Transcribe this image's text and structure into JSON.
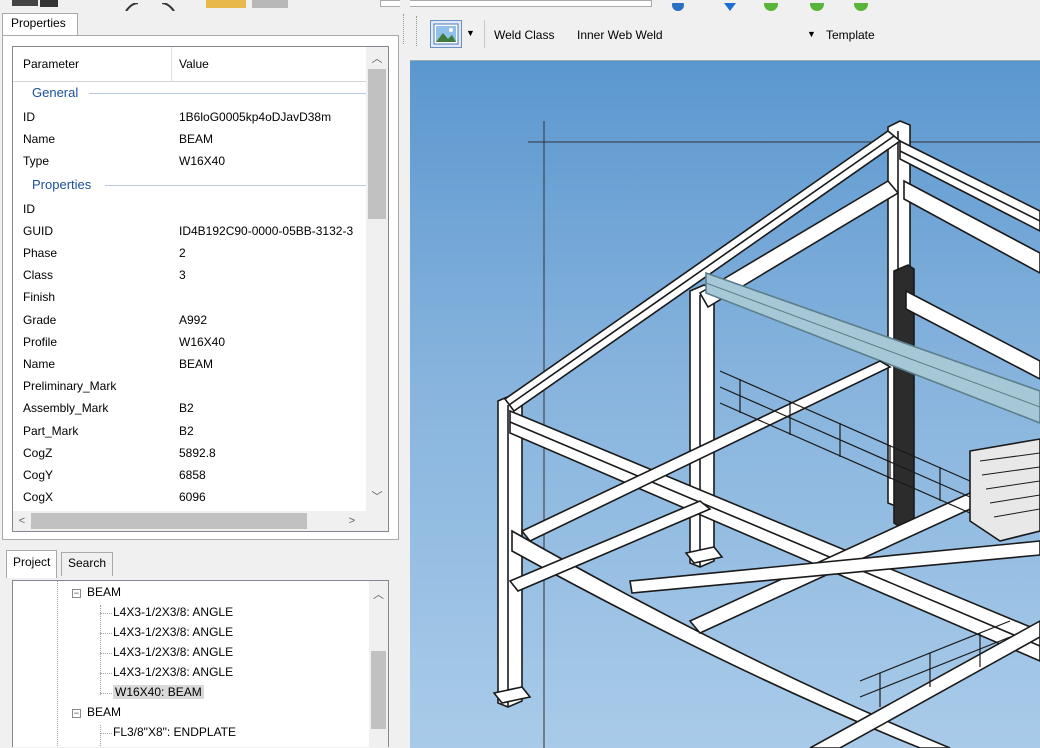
{
  "properties_panel": {
    "tab_label": "Properties",
    "columns": {
      "parameter": "Parameter",
      "value": "Value"
    },
    "categories": [
      {
        "title": "General",
        "rows": [
          {
            "k": "ID",
            "v": "1B6loG0005kp4oDJavD38m"
          },
          {
            "k": "Name",
            "v": "BEAM"
          },
          {
            "k": "Type",
            "v": "W16X40"
          }
        ]
      },
      {
        "title": "Properties",
        "rows": [
          {
            "k": "ID",
            "v": ""
          },
          {
            "k": "GUID",
            "v": "ID4B192C90-0000-05BB-3132-3"
          },
          {
            "k": "Phase",
            "v": "2"
          },
          {
            "k": "Class",
            "v": "3"
          },
          {
            "k": "Finish",
            "v": ""
          },
          {
            "k": "Grade",
            "v": "A992"
          },
          {
            "k": "Profile",
            "v": "W16X40"
          },
          {
            "k": "Name",
            "v": "BEAM"
          },
          {
            "k": "Preliminary_Mark",
            "v": ""
          },
          {
            "k": "Assembly_Mark",
            "v": "B2"
          },
          {
            "k": "Part_Mark",
            "v": "B2"
          },
          {
            "k": "CogZ",
            "v": "5892.8"
          },
          {
            "k": "CogY",
            "v": "6858"
          },
          {
            "k": "CogX",
            "v": "6096"
          }
        ]
      }
    ]
  },
  "project_panel": {
    "tabs": [
      "Project",
      "Search"
    ],
    "tree": [
      {
        "label": "BEAM",
        "level": 0,
        "expander": "−"
      },
      {
        "label": "L4X3-1/2X3/8: ANGLE",
        "level": 1
      },
      {
        "label": "L4X3-1/2X3/8: ANGLE",
        "level": 1
      },
      {
        "label": "L4X3-1/2X3/8: ANGLE",
        "level": 1
      },
      {
        "label": "L4X3-1/2X3/8: ANGLE",
        "level": 1
      },
      {
        "label": "W16X40: BEAM",
        "level": 1,
        "selected": true
      },
      {
        "label": "BEAM",
        "level": 0,
        "expander": "−"
      },
      {
        "label": "FL3/8\"X8\": ENDPLATE",
        "level": 1
      }
    ]
  },
  "viewer_toolbar": {
    "weld_class_label": "Weld Class",
    "weld_class_value": "Inner Web Weld",
    "template_label": "Template"
  },
  "icons": {
    "view_mode": "picture-icon",
    "dropdown": "chevron-down-icon",
    "tree_expander": "minus-box-icon"
  },
  "colors": {
    "selection": "#d9d9d9",
    "category_text": "#1a4f9c",
    "viewport_top": "#5b97cf",
    "viewport_bottom": "#a9cbe9",
    "highlight_beam": "#a6c8d6"
  }
}
